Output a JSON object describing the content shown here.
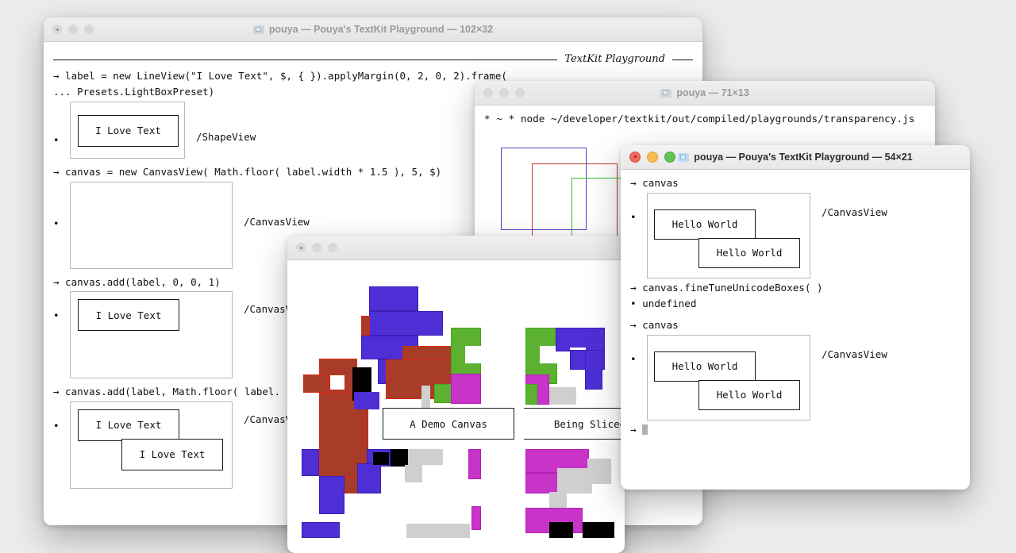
{
  "desktop": {
    "background": "#ececec"
  },
  "windows": {
    "playground_main": {
      "title": "pouya — Pouya's TextKit Playground — 102×32",
      "icon": "folder-icon",
      "active": false,
      "header_caption": "TextKit Playground",
      "lines": [
        "→ label = new LineView(\"I Love Text\", $, { }).applyMargin(0, 2, 0, 2).frame(",
        "... Presets.LightBoxPreset)"
      ],
      "results": [
        {
          "type": "ShapeView",
          "label": "/ShapeView",
          "inner_text": "I Love Text"
        },
        {
          "type": "CanvasView",
          "label": "/CanvasView",
          "inner_text": ""
        },
        {
          "type": "CanvasView",
          "label": "/CanvasV",
          "inner_text": "I Love Text"
        },
        {
          "type": "CanvasView",
          "label": "/CanvasV",
          "inner_text": "I Love Text",
          "inner_text2": "I Love Text"
        }
      ],
      "commands": [
        "→ canvas = new CanvasView( Math.floor( label.width * 1.5 ), 5, $)",
        "→ canvas.add(label, 0, 0, 1)",
        "→ canvas.add(label, Math.floor( label."
      ],
      "label_text": "I Love Text"
    },
    "node_terminal": {
      "title": "pouya — 71×13",
      "icon": "folder-icon",
      "active": false,
      "command_line": "* ~ * node ~/developer/textkit/out/compiled/playgrounds/transparency.js",
      "prompt_line": "* ~ *",
      "rectangles": [
        {
          "name": "blue-rectangle",
          "color": "#4b45c6"
        },
        {
          "name": "red-rectangle",
          "color": "#c0392b"
        },
        {
          "name": "green-rectangle",
          "color": "#2dbf2d"
        }
      ]
    },
    "pixel_canvas": {
      "title": "",
      "active": false,
      "captions": [
        "A Demo Canvas",
        "Being Sliced"
      ],
      "palette": {
        "blue": "#4e2fd6",
        "blue_border": "#3a1fb8",
        "brown": "#a93c28",
        "brown_border": "#d42b17",
        "green": "#5cb230",
        "green_border": "#3fa815",
        "magenta": "#c833c8",
        "magenta_border": "#b322b3",
        "gray": "#cfcfcf",
        "black": "#000000"
      }
    },
    "playground_front": {
      "title": "pouya — Pouya's TextKit Playground — 54×21",
      "icon": "folder-icon",
      "active": true,
      "lines": [
        {
          "kind": "prompt",
          "text": "→ canvas"
        },
        {
          "kind": "view",
          "label": "/CanvasView",
          "inner_text": "Hello World",
          "inner_text2": "Hello World"
        },
        {
          "kind": "prompt",
          "text": "→ canvas.fineTuneUnicodeBoxes( )"
        },
        {
          "kind": "result",
          "text": "• undefined"
        },
        {
          "kind": "prompt",
          "text": "→ canvas"
        },
        {
          "kind": "view",
          "label": "/CanvasView",
          "inner_text": "Hello World",
          "inner_text2": "Hello World"
        },
        {
          "kind": "cursor",
          "text": "→"
        }
      ],
      "hello_text": "Hello World",
      "canvas_label": "/CanvasView",
      "undefined_text": "• undefined",
      "prompt_canvas": "→ canvas",
      "prompt_finetune": "→ canvas.fineTuneUnicodeBoxes( )",
      "prompt_empty": "→"
    }
  }
}
